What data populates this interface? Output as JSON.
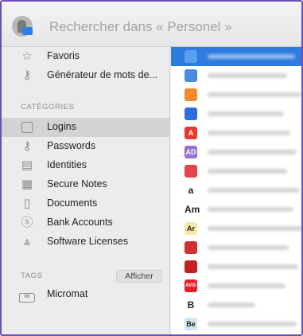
{
  "search": {
    "placeholder": "Rechercher dans « Personel »"
  },
  "sidebar": {
    "top_items": [
      {
        "label": "Favoris",
        "icon": "star-icon"
      },
      {
        "label": "Générateur de mots de...",
        "icon": "key-icon"
      }
    ],
    "categories_title": "CATÉGORIES",
    "categories": [
      {
        "label": "Logins",
        "icon": "login-icon",
        "selected": true
      },
      {
        "label": "Passwords",
        "icon": "key-icon"
      },
      {
        "label": "Identities",
        "icon": "id-card-icon"
      },
      {
        "label": "Secure Notes",
        "icon": "note-icon"
      },
      {
        "label": "Documents",
        "icon": "document-icon"
      },
      {
        "label": "Bank Accounts",
        "icon": "dollar-icon"
      },
      {
        "label": "Software Licenses",
        "icon": "app-icon"
      }
    ],
    "tags_title": "TAGS",
    "tags_show_label": "Afficher",
    "tags": [
      {
        "label": "Micromat",
        "icon": "tag-icon",
        "badge": "MI"
      }
    ]
  },
  "list": {
    "items": [
      {
        "icon_text": "",
        "color": "#5aa0f0",
        "selected": true
      },
      {
        "icon_text": "",
        "color": "#4a8be0"
      },
      {
        "icon_text": "",
        "color": "#f28a2e"
      },
      {
        "icon_text": "",
        "color": "#2e6fe0"
      },
      {
        "icon_text": "A",
        "color": "#e53b2f"
      },
      {
        "icon_text": "AD",
        "color": "#9a6fd0"
      },
      {
        "icon_text": "",
        "color": "#e8454a"
      },
      {
        "icon_text": "a",
        "color": "#ffffff"
      },
      {
        "icon_text": "Am",
        "color": "#ffffff"
      },
      {
        "icon_text": "Ar",
        "color": "#f4e9a8"
      },
      {
        "icon_text": "",
        "color": "#d62e2e"
      },
      {
        "icon_text": "",
        "color": "#c22222"
      },
      {
        "icon_text": "AVIS",
        "color": "#e3202a"
      },
      {
        "icon_text": "B",
        "color": "#ffffff"
      },
      {
        "icon_text": "Be",
        "color": "#cfe6f4"
      }
    ]
  }
}
